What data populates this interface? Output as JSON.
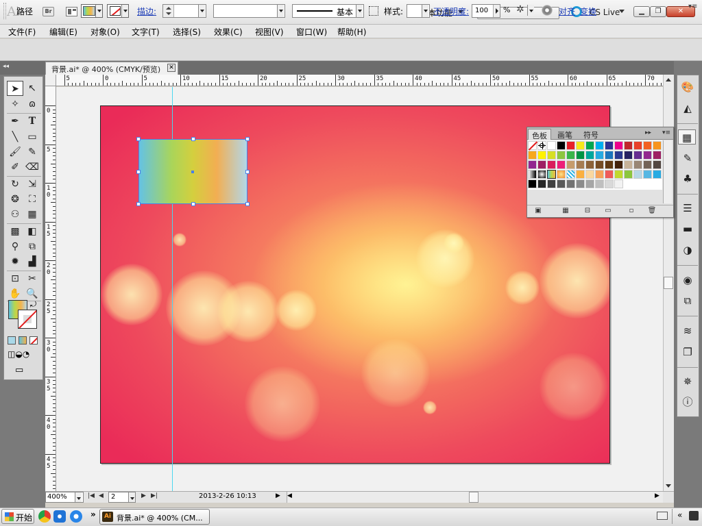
{
  "titlebar": {
    "logo": "Ai",
    "bridge": "Br",
    "workspace": "基本功能",
    "search_placeholder": "",
    "cslive": "CS Live",
    "minimize": "▁",
    "maximize": "❐",
    "close": "✕"
  },
  "menu": {
    "file": "文件(F)",
    "edit": "编辑(E)",
    "object": "对象(O)",
    "type": "文字(T)",
    "select": "选择(S)",
    "effect": "效果(C)",
    "view": "视图(V)",
    "window": "窗口(W)",
    "help": "帮助(H)"
  },
  "control": {
    "mode": "路径",
    "stroke_label": "描边:",
    "brush": "基本",
    "style_label": "样式:",
    "opacity_label": "不透明度:",
    "opacity_value": "100",
    "percent": "%",
    "align": "对齐",
    "transform": "变换",
    "panel_menu": "▾≡"
  },
  "document": {
    "tab_title": "背景.ai* @ 400% (CMYK/预览)",
    "close": "✕"
  },
  "ruler": {
    "h_labels": [
      "5",
      "0",
      "5",
      "10",
      "15",
      "20",
      "25",
      "30",
      "35",
      "40",
      "45",
      "50",
      "55",
      "60",
      "65",
      "70"
    ],
    "v_labels": [
      "0",
      "5",
      "10",
      "15",
      "20",
      "25",
      "30",
      "35",
      "40",
      "45"
    ]
  },
  "status": {
    "zoom": "400%",
    "page": "2",
    "text": "2013-2-26  10:13"
  },
  "swatches": {
    "tabs": [
      "色板",
      "画笔",
      "符号"
    ],
    "collapse": "▸▸",
    "menu": "▾≡",
    "rows": [
      [
        "none",
        "reg",
        "#ffffff",
        "#000000",
        "#e8202a",
        "#f5e81c",
        "#00a650",
        "#00aeef",
        "#2e3192",
        "#ec008c",
        "#c1272d",
        "#e8402a",
        "#f26122",
        "#f7941d"
      ],
      [
        "#f7a81b",
        "#fff200",
        "#d7df23",
        "#8dc63f",
        "#39b54a",
        "#009444",
        "#00a79d",
        "#27aae1",
        "#1c75bc",
        "#2b3990",
        "#262262",
        "#662d91",
        "#92278f",
        "#9e1f63"
      ],
      [
        "#92278f",
        "#9e1f63",
        "#d91c5c",
        "#ed1e79",
        "#c69c6d",
        "#a67c52",
        "#8c6239",
        "#754c24",
        "#603913",
        "#42210b",
        "#c7b299",
        "#998675",
        "#736357",
        "#534741"
      ],
      [
        "grad1",
        "grad2",
        "grad3",
        "grad4",
        "pattern",
        "#fbb040",
        "#f9d7a0",
        "#f6a25a",
        "#ef5a5a",
        "#c1d82f",
        "#8cc63e",
        "#b7d7e6",
        "#56b7e3",
        "#29abe2"
      ],
      [
        "#000000",
        "#262626",
        "#404040",
        "#595959",
        "#737373",
        "#8c8c8c",
        "#a6a6a6",
        "#bfbfbf",
        "#d9d9d9",
        "#f2f2f2"
      ]
    ]
  },
  "taskbar": {
    "start": "开始",
    "more": "»",
    "task": "背景.ai* @ 400% (CM...",
    "ai_icon": "Ai",
    "tray_arrow": "«"
  }
}
